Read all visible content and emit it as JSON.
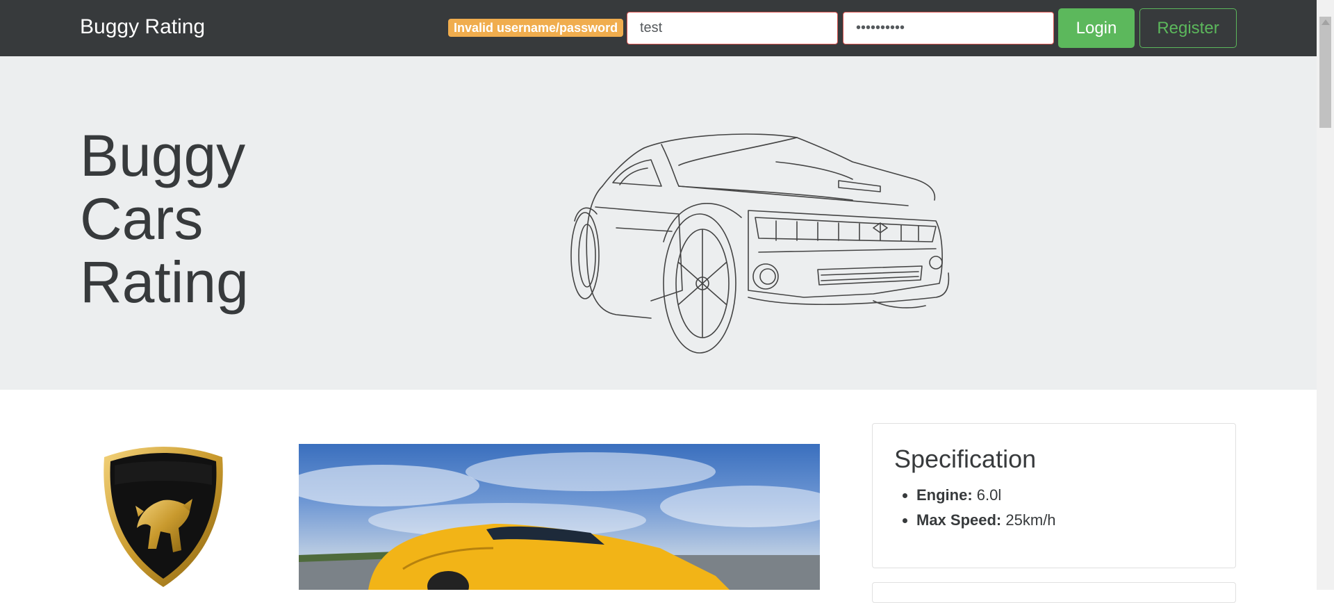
{
  "navbar": {
    "brand": "Buggy Rating",
    "error_message": "Invalid username/password",
    "username_value": "test",
    "password_value": "••••••••••",
    "login_label": "Login",
    "register_label": "Register"
  },
  "hero": {
    "title": "Buggy Cars Rating"
  },
  "car": {
    "make_logo_text": "LAMBORGHINI",
    "specification_title": "Specification",
    "specs": [
      {
        "label": "Engine:",
        "value": "6.0l"
      },
      {
        "label": "Max Speed:",
        "value": "25km/h"
      }
    ]
  },
  "colors": {
    "navbar": "#373a3c",
    "jumbotron": "#eceeef",
    "success": "#5cb85c",
    "warning": "#f0ad4e",
    "danger": "#d9534f"
  }
}
